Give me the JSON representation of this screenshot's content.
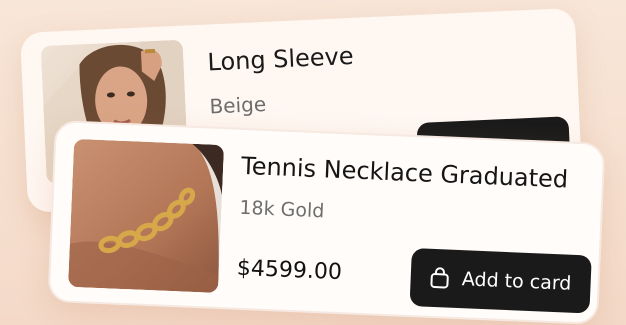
{
  "products": [
    {
      "title": "Long Sleeve",
      "variant": "Beige",
      "image_icon": "woman-portrait-image"
    },
    {
      "title": "Tennis Necklace Graduated",
      "variant": "18k Gold",
      "price": "$4599.00",
      "button_label": "Add to card",
      "button_icon": "shopping-bag-icon",
      "image_icon": "gold-chain-necklace-image"
    }
  ],
  "colors": {
    "background": "#f6dfcf",
    "card": "#fffcfa",
    "button": "#1a1a1a",
    "button_text": "#ffffff",
    "muted_text": "#6e6e6e"
  }
}
